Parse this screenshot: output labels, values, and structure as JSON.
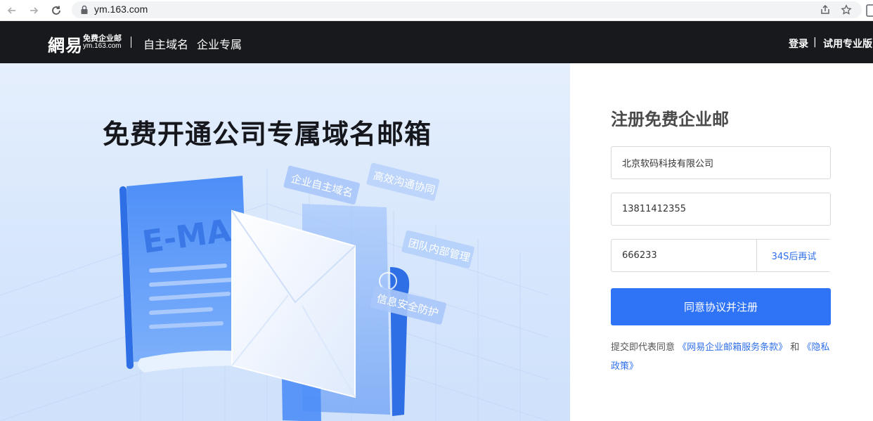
{
  "browser": {
    "url": "ym.163.com"
  },
  "header": {
    "logo_main": "網易",
    "logo_sub_cn": "免费企业邮",
    "logo_sub_en": "ym.163.com",
    "nav": [
      "自主域名",
      "企业专属"
    ],
    "login_label": "登录",
    "separator": "|",
    "trial_label": "试用专业版"
  },
  "hero": {
    "title": "免费开通公司专属域名邮箱",
    "illustration": {
      "doc_text": "E-MAIL",
      "tags": [
        "企业自主域名",
        "高效沟通协同",
        "团队内部管理",
        "信息安全防护"
      ]
    }
  },
  "form": {
    "title": "注册免费企业邮",
    "company_value": "北京软码科技有限公司",
    "phone_value": "13811412355",
    "code_value": "666233",
    "code_button_label": "34S后再试",
    "submit_label": "同意协议并注册",
    "agreement_prefix": "提交即代表同意 ",
    "terms_link": "《网易企业邮箱服务条款》",
    "agreement_and": " 和 ",
    "privacy_link": "《隐私政策》"
  },
  "colors": {
    "header_bg": "#17191d",
    "accent": "#2f73f6",
    "link": "#2f6fea"
  }
}
